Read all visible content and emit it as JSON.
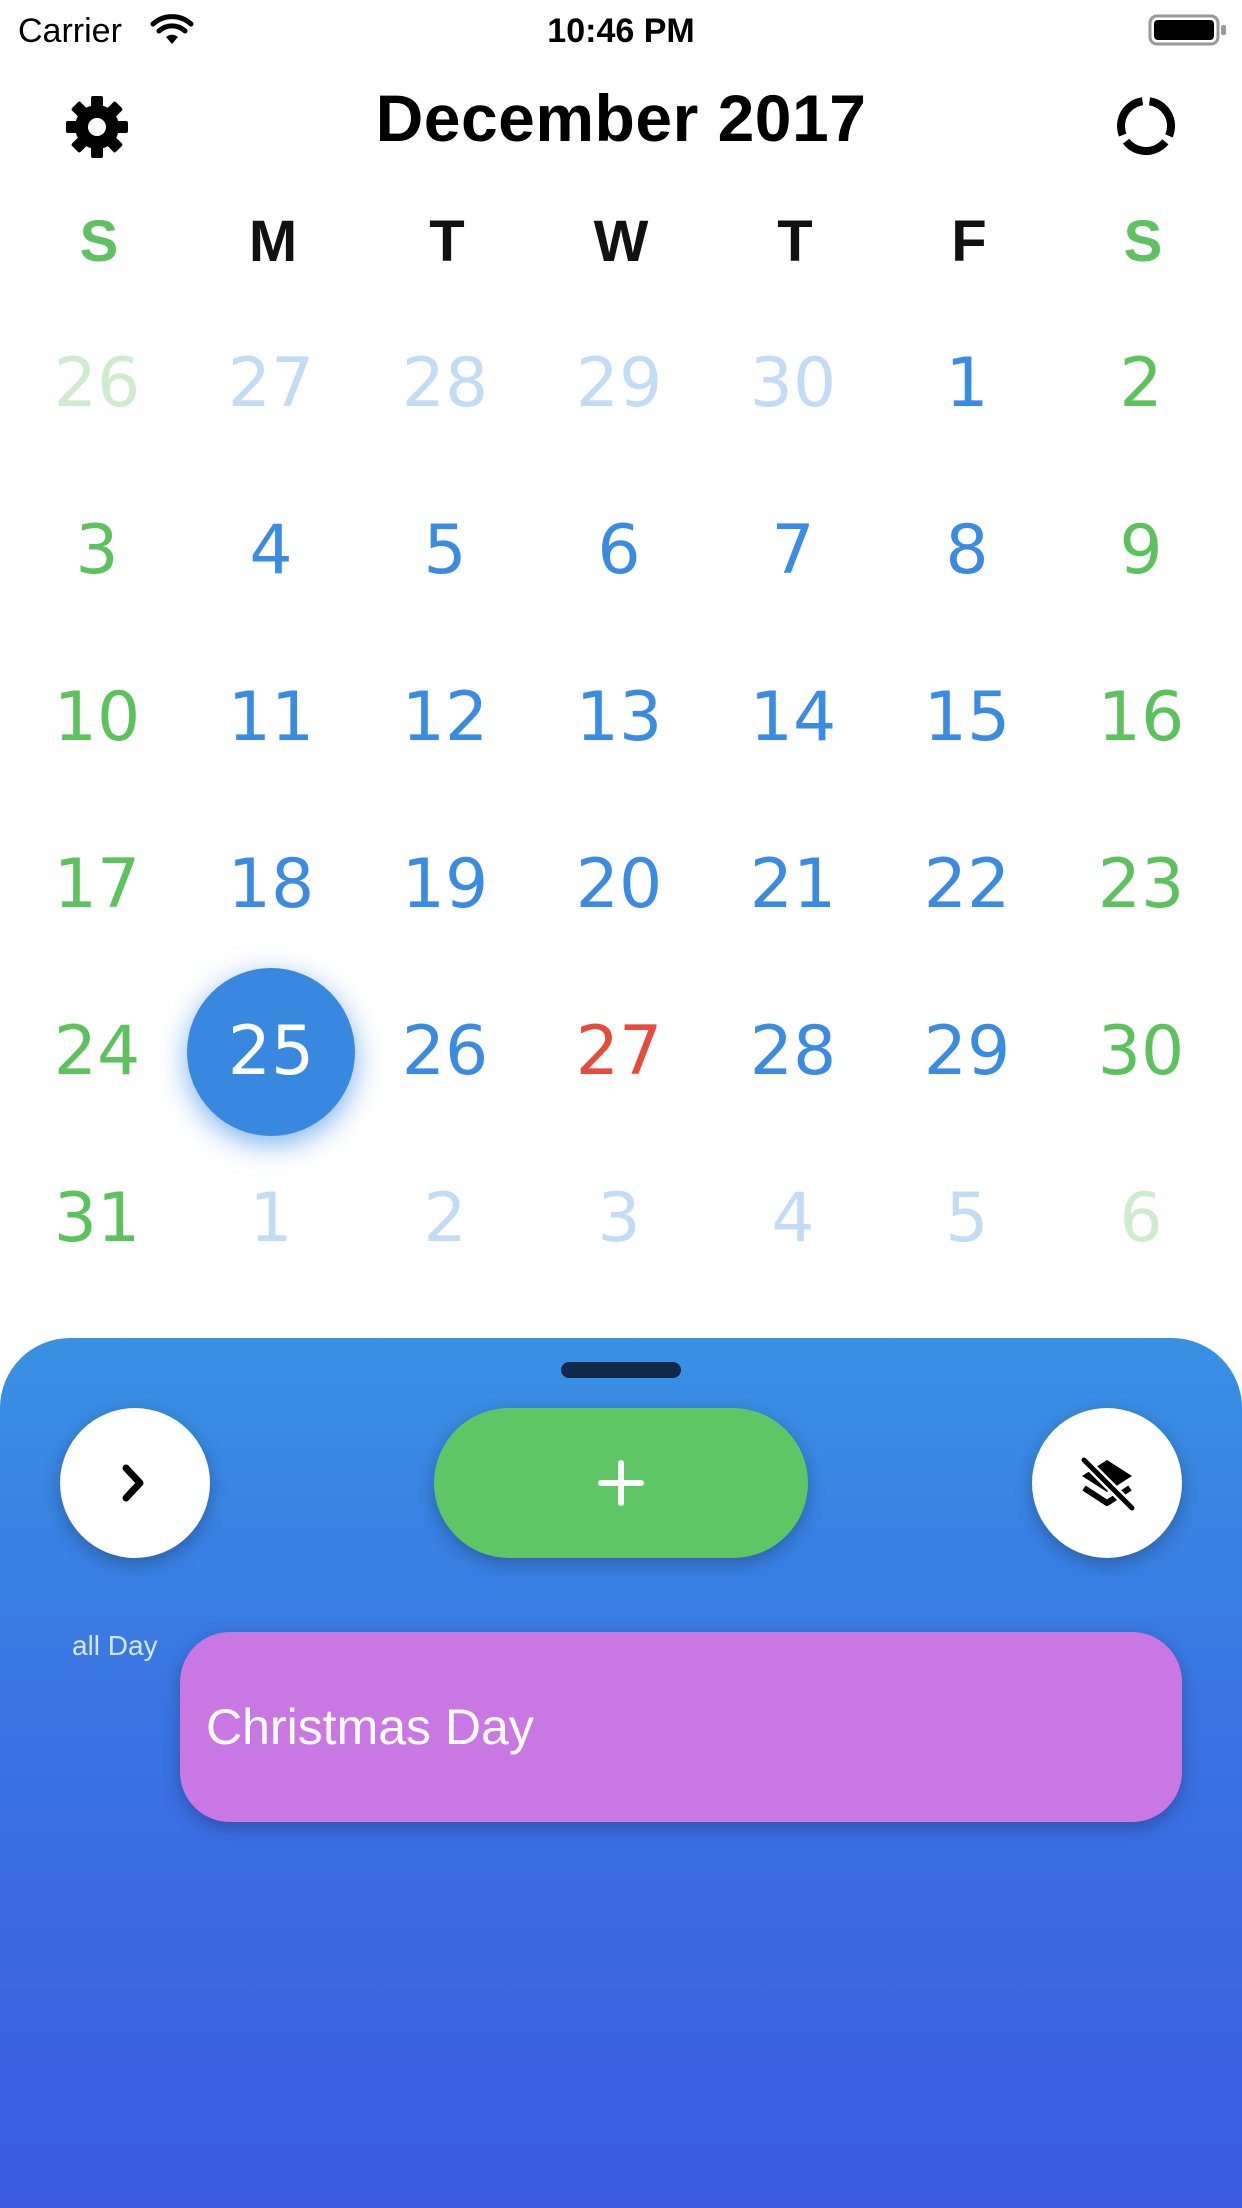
{
  "status_bar": {
    "carrier": "Carrier",
    "time": "10:46 PM"
  },
  "header": {
    "title": "December 2017"
  },
  "weekdays": [
    "S",
    "M",
    "T",
    "W",
    "T",
    "F",
    "S"
  ],
  "weeks": [
    [
      {
        "d": "26",
        "t": "fadegreen"
      },
      {
        "d": "27",
        "t": "fadeblue"
      },
      {
        "d": "28",
        "t": "fadeblue"
      },
      {
        "d": "29",
        "t": "fadeblue"
      },
      {
        "d": "30",
        "t": "fadeblue"
      },
      {
        "d": "1",
        "t": "blue"
      },
      {
        "d": "2",
        "t": "green"
      }
    ],
    [
      {
        "d": "3",
        "t": "green"
      },
      {
        "d": "4",
        "t": "blue"
      },
      {
        "d": "5",
        "t": "blue"
      },
      {
        "d": "6",
        "t": "blue"
      },
      {
        "d": "7",
        "t": "blue"
      },
      {
        "d": "8",
        "t": "blue"
      },
      {
        "d": "9",
        "t": "green"
      }
    ],
    [
      {
        "d": "10",
        "t": "green"
      },
      {
        "d": "11",
        "t": "blue"
      },
      {
        "d": "12",
        "t": "blue"
      },
      {
        "d": "13",
        "t": "blue"
      },
      {
        "d": "14",
        "t": "blue"
      },
      {
        "d": "15",
        "t": "blue"
      },
      {
        "d": "16",
        "t": "green"
      }
    ],
    [
      {
        "d": "17",
        "t": "green"
      },
      {
        "d": "18",
        "t": "blue"
      },
      {
        "d": "19",
        "t": "blue"
      },
      {
        "d": "20",
        "t": "blue"
      },
      {
        "d": "21",
        "t": "blue"
      },
      {
        "d": "22",
        "t": "blue"
      },
      {
        "d": "23",
        "t": "green"
      }
    ],
    [
      {
        "d": "24",
        "t": "green"
      },
      {
        "d": "25",
        "t": "selected"
      },
      {
        "d": "26",
        "t": "blue"
      },
      {
        "d": "27",
        "t": "red"
      },
      {
        "d": "28",
        "t": "blue"
      },
      {
        "d": "29",
        "t": "blue"
      },
      {
        "d": "30",
        "t": "green"
      }
    ],
    [
      {
        "d": "31",
        "t": "green"
      },
      {
        "d": "1",
        "t": "fadeblue"
      },
      {
        "d": "2",
        "t": "fadeblue"
      },
      {
        "d": "3",
        "t": "fadeblue"
      },
      {
        "d": "4",
        "t": "fadeblue"
      },
      {
        "d": "5",
        "t": "fadeblue"
      },
      {
        "d": "6",
        "t": "fadegreen"
      }
    ]
  ],
  "sheet": {
    "all_day_label": "all Day",
    "event_title": "Christmas Day",
    "add_label": "+"
  },
  "colors": {
    "weekday_blue": "#3a8be2",
    "weekend_green": "#5cc25c",
    "today_red": "#e84a3c",
    "selected_fill": "#3888e0",
    "add_button": "#5ec665",
    "event_fill": "#c977e3"
  },
  "icons": {
    "settings": "gear-icon",
    "sync": "sync-icon",
    "next": "chevron-right-icon",
    "layers": "layers-off-icon",
    "add": "plus-icon"
  }
}
